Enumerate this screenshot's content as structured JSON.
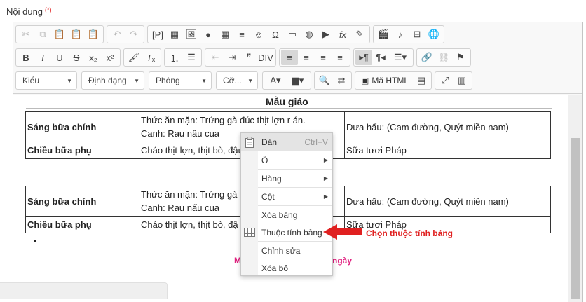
{
  "field": {
    "label": "Nội dung",
    "required_mark": "(*)"
  },
  "toolbar": {
    "row3": {
      "style_combo": "Kiểu",
      "format_combo": "Định dạng",
      "font_combo": "Phông",
      "size_combo": "Cỡ...",
      "source_label": "Mã HTML"
    }
  },
  "document": {
    "heading": "Mẫu giáo",
    "tables": [
      {
        "rows": [
          {
            "c1": "Sáng bữa chính",
            "c2a": "Thức ăn mặn: Trứng gà đúc thịt lợn r án.",
            "c2b": "Canh: Rau nấu cua",
            "c3": "Dưa hấu: (Cam đường, Quýt miền nam)"
          },
          {
            "c1": "Chiều bữa phụ",
            "c2a": "Cháo thịt lợn, thịt bò, đậu",
            "c2b": "",
            "c3": "Sữa tươi Pháp"
          }
        ]
      },
      {
        "rows": [
          {
            "c1": "Sáng bữa chính",
            "c2a": "Thức ăn mặn: Trứng gà đ",
            "c2b": "Canh: Rau nấu cua",
            "c3": "Dưa hấu: (Cam đường, Quýt miền nam)"
          },
          {
            "c1": "Chiều bữa phụ",
            "c2a": "Cháo thịt lợn, thịt bò, đậ",
            "c2b": "",
            "c3": "Sữa tươi Pháp"
          }
        ]
      }
    ],
    "bullet": "•",
    "pink_left": "M",
    "pink_right": "ngày"
  },
  "context_menu": {
    "items": [
      {
        "label": "Dán",
        "shortcut": "Ctrl+V"
      },
      {
        "label": "Ô",
        "submenu": "▶"
      },
      {
        "label": "Hàng",
        "submenu": "▶"
      },
      {
        "label": "Cột",
        "submenu": "▶"
      },
      {
        "label": "Xóa bảng"
      },
      {
        "label": "Thuộc tính bảng"
      },
      {
        "label": "Chỉnh sửa"
      },
      {
        "label": "Xóa bỏ"
      }
    ]
  },
  "annotation": {
    "text": "Chọn thuộc tính bảng",
    "color": "#e02020"
  },
  "colors": {
    "accent_pink": "#e0217f",
    "annotation_red": "#e02020"
  }
}
